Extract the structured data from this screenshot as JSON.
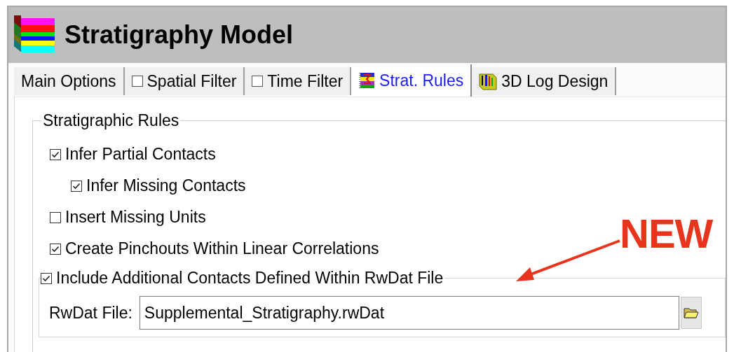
{
  "window": {
    "title": "Stratigraphy Model"
  },
  "tabs": [
    {
      "label": "Main Options",
      "kind": "plain",
      "selected": false
    },
    {
      "label": "Spatial Filter",
      "kind": "checkbox",
      "checked": false,
      "selected": false
    },
    {
      "label": "Time Filter",
      "kind": "checkbox",
      "checked": false,
      "selected": false
    },
    {
      "label": "Strat. Rules",
      "kind": "rules",
      "selected": true
    },
    {
      "label": "3D Log Design",
      "kind": "log",
      "selected": false
    }
  ],
  "group": {
    "title": "Stratigraphic Rules",
    "options": [
      {
        "label": "Infer Partial Contacts",
        "checked": true,
        "children": [
          {
            "label": "Infer Missing Contacts",
            "checked": true
          }
        ]
      },
      {
        "label": "Insert Missing Units",
        "checked": false
      },
      {
        "label": "Create Pinchouts Within Linear Correlations",
        "checked": true
      }
    ],
    "subgroup": {
      "label": "Include Additional Contacts Defined Within RwDat File",
      "checked": true,
      "field_label": "RwDat File:",
      "value": "Supplemental_Stratigraphy.rwDat"
    }
  },
  "annotation": {
    "text": "NEW"
  }
}
